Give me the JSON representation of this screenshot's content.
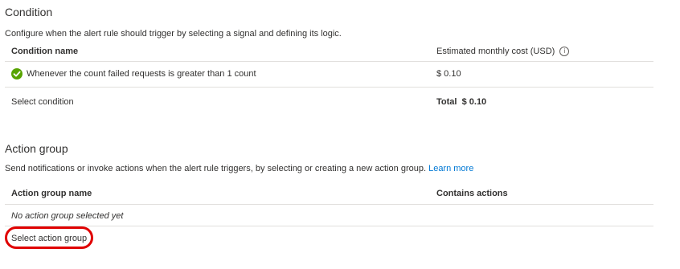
{
  "condition": {
    "title": "Condition",
    "description": "Configure when the alert rule should trigger by selecting a signal and defining its logic.",
    "col_name": "Condition name",
    "col_cost": "Estimated monthly cost (USD)",
    "info_glyph": "i",
    "rows": [
      {
        "name": "Whenever the count failed requests is greater than 1 count",
        "cost": "$ 0.10",
        "status_icon": "check-circle-icon"
      }
    ],
    "select_label": "Select condition",
    "total_label": "Total",
    "total_value": "$ 0.10"
  },
  "action_group": {
    "title": "Action group",
    "description": "Send notifications or invoke actions when the alert rule triggers, by selecting or creating a new action group.",
    "learn_more": "Learn more",
    "col_name": "Action group name",
    "col_actions": "Contains actions",
    "empty_text": "No action group selected yet",
    "select_label": "Select action group"
  },
  "colors": {
    "link": "#0078d4",
    "success": "#57a300",
    "highlight": "#e00000"
  }
}
